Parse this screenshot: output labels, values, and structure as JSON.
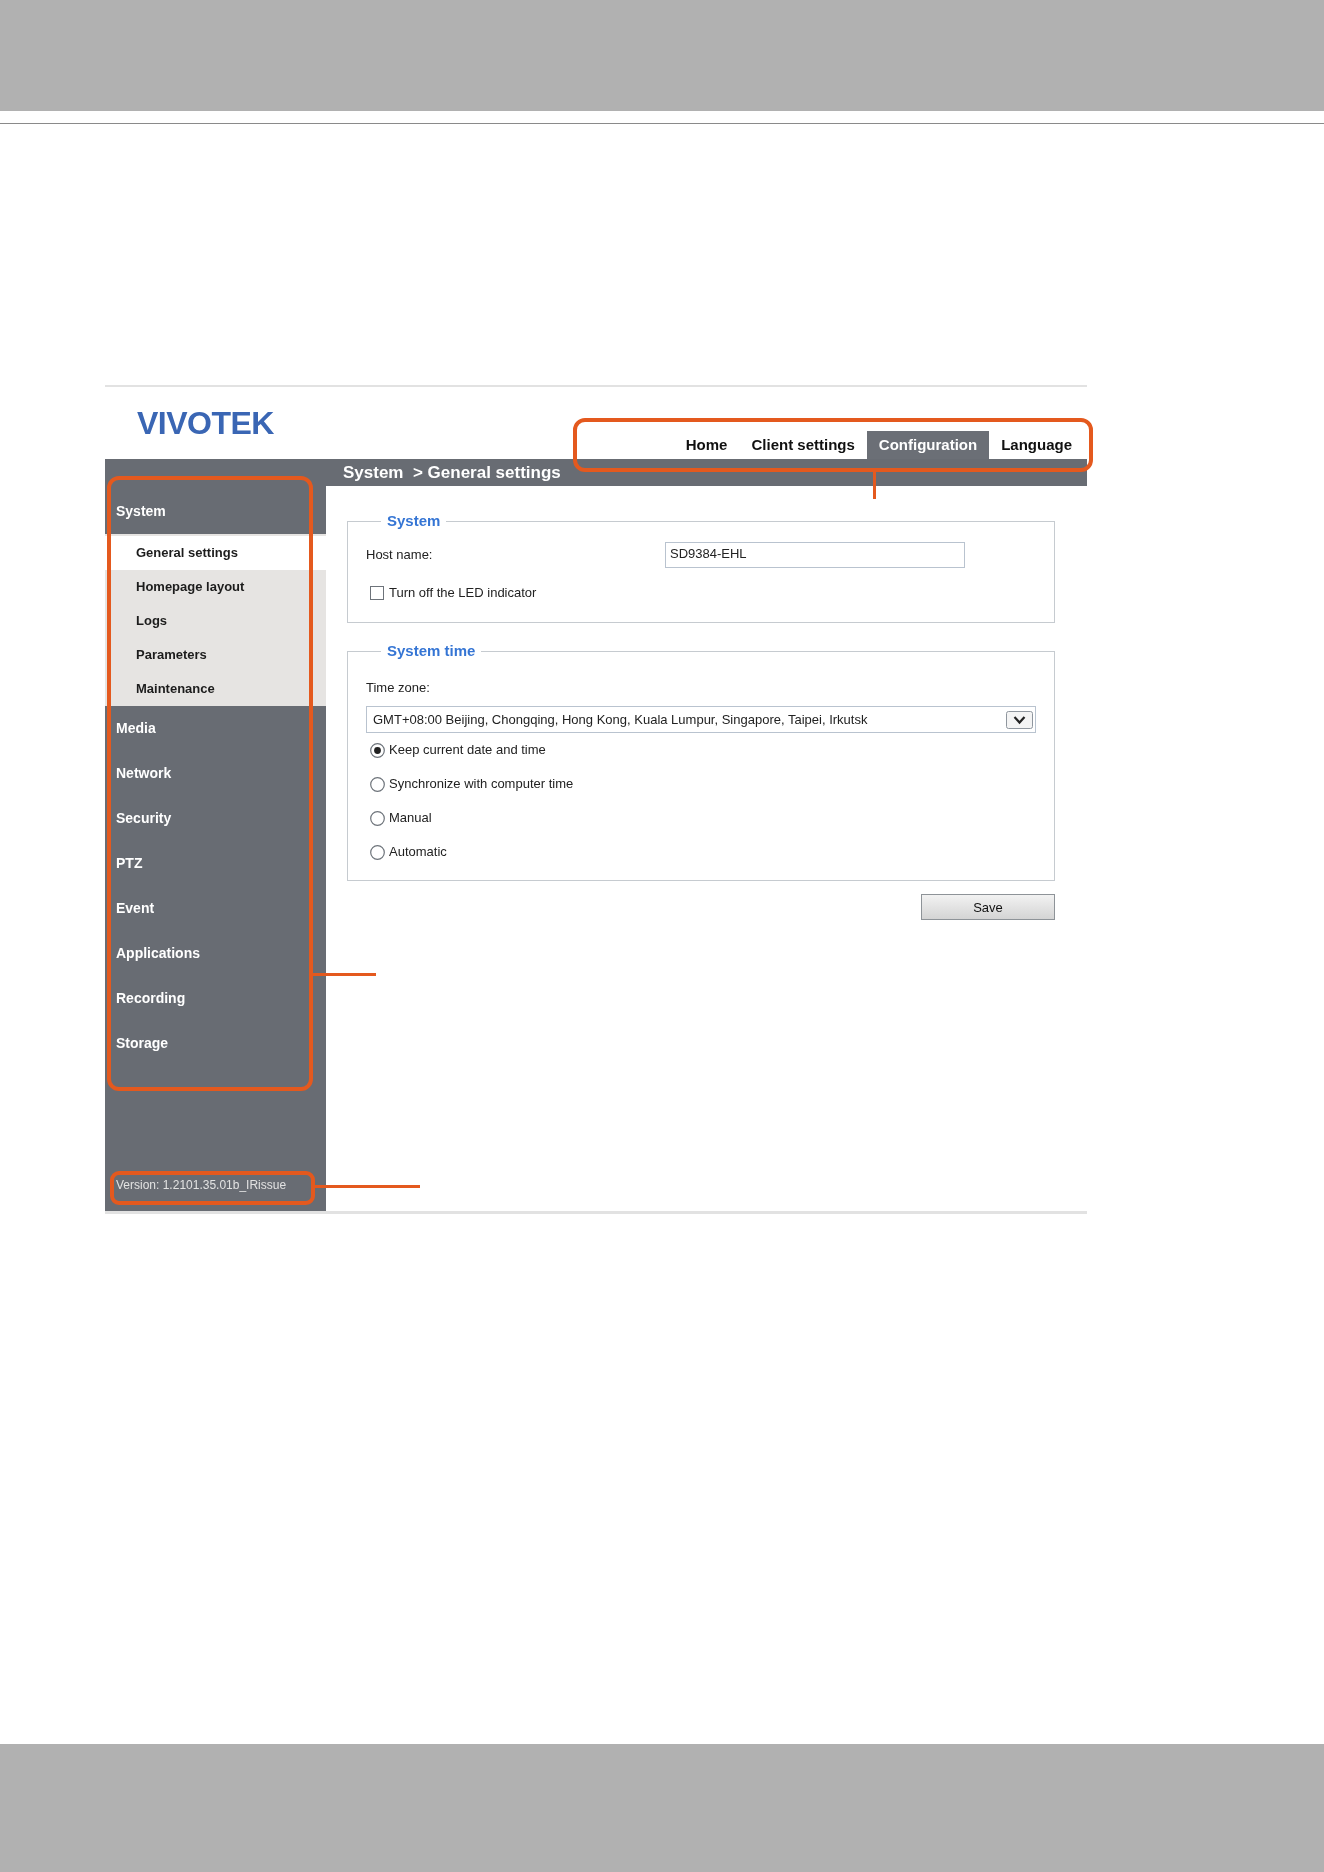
{
  "header": {
    "logo": "VIVOTEK",
    "nav": [
      {
        "label": "Home",
        "selected": false
      },
      {
        "label": "Client settings",
        "selected": false
      },
      {
        "label": "Configuration",
        "selected": true
      },
      {
        "label": "Language",
        "selected": false
      }
    ]
  },
  "breadcrumb": "System  > General settings",
  "sidebar": {
    "items": [
      {
        "label": "System",
        "children": [
          {
            "label": "General settings",
            "selected": true
          },
          {
            "label": "Homepage layout",
            "selected": false
          },
          {
            "label": "Logs",
            "selected": false
          },
          {
            "label": "Parameters",
            "selected": false
          },
          {
            "label": "Maintenance",
            "selected": false
          }
        ]
      },
      {
        "label": "Media"
      },
      {
        "label": "Network"
      },
      {
        "label": "Security"
      },
      {
        "label": "PTZ"
      },
      {
        "label": "Event"
      },
      {
        "label": "Applications"
      },
      {
        "label": "Recording"
      },
      {
        "label": "Storage"
      }
    ],
    "version": "Version: 1.2101.35.01b_IRissue"
  },
  "system": {
    "legend": "System",
    "host_name": {
      "label": "Host name:",
      "value": "SD9384-EHL"
    },
    "led": {
      "label": "Turn off the LED indicator",
      "checked": false
    }
  },
  "system_time": {
    "legend": "System time",
    "time_zone": {
      "label": "Time zone:",
      "value": "GMT+08:00 Beijing, Chongqing, Hong Kong, Kuala Lumpur, Singapore, Taipei, Irkutsk"
    },
    "options": [
      {
        "label": "Keep current date and time",
        "selected": true
      },
      {
        "label": "Synchronize with computer time",
        "selected": false
      },
      {
        "label": "Manual",
        "selected": false
      },
      {
        "label": "Automatic",
        "selected": false
      }
    ]
  },
  "save_button": "Save"
}
